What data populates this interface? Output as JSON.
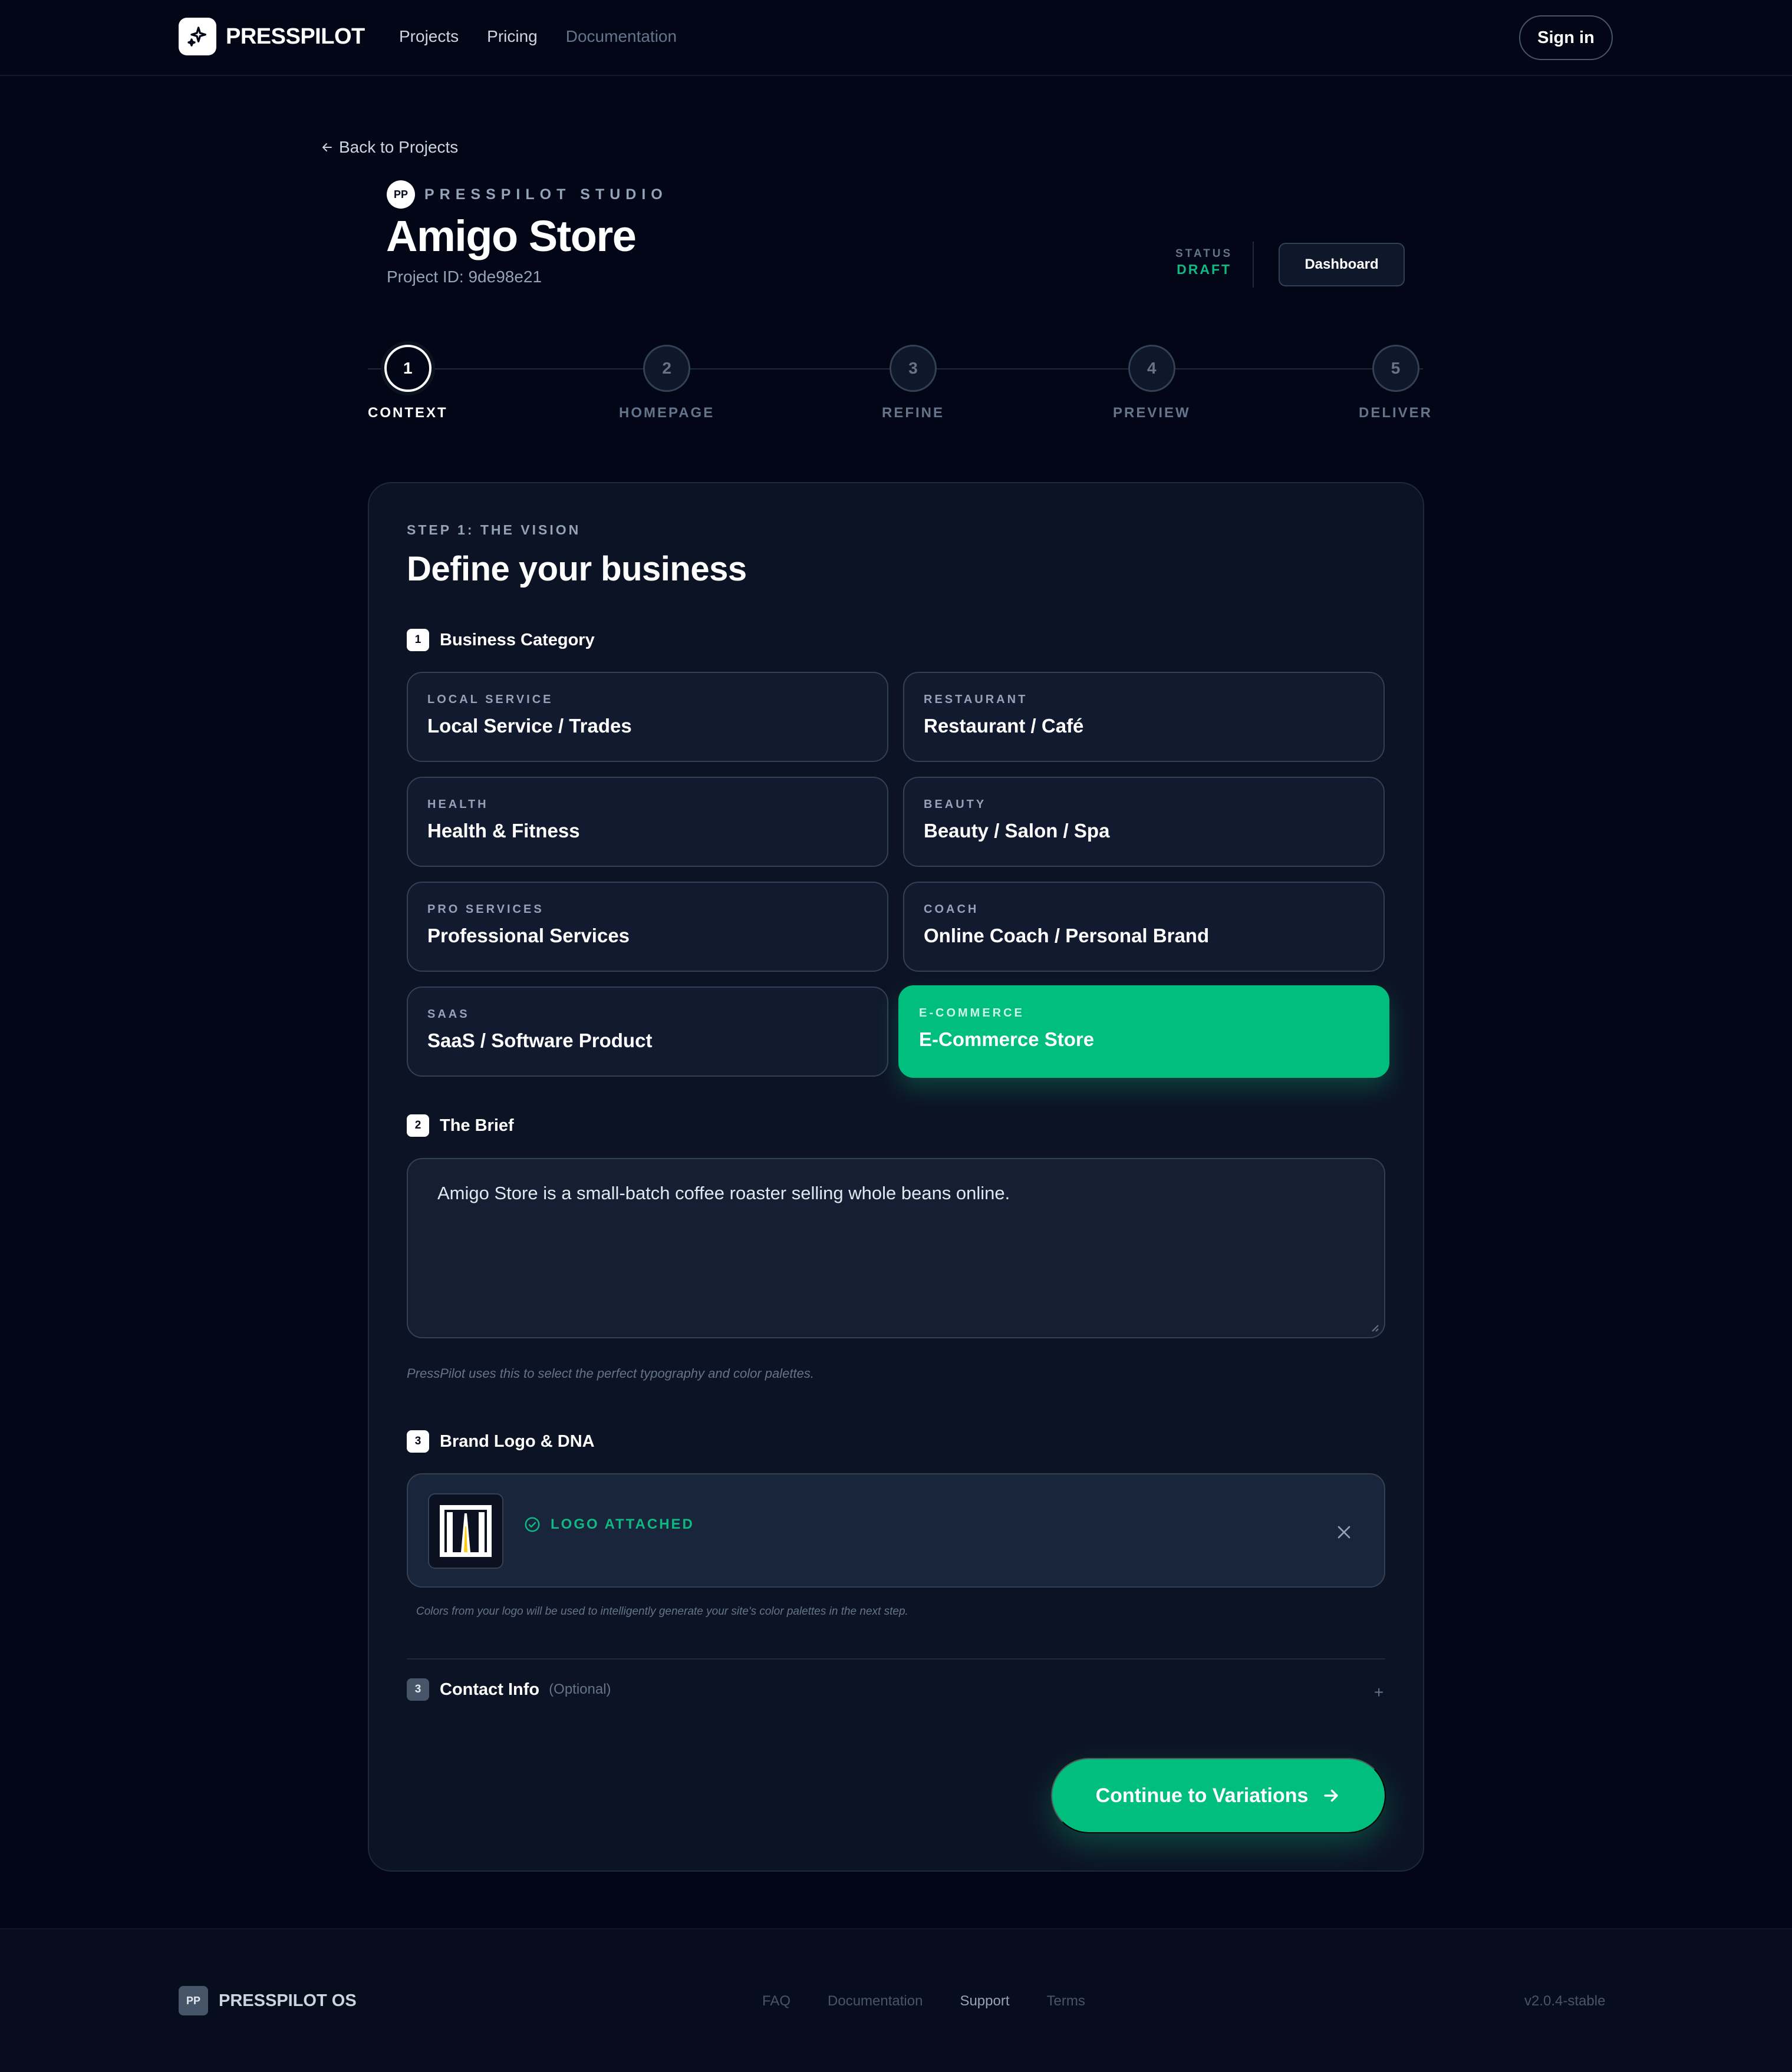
{
  "nav": {
    "brand": "PRESSPILOT",
    "links": [
      "Projects",
      "Pricing",
      "Documentation"
    ],
    "signin": "Sign in"
  },
  "header": {
    "back": "Back to Projects",
    "studio_badge": "PP",
    "studio_label": "PRESSPILOT STUDIO",
    "title": "Amigo Store",
    "project_id": "Project ID: 9de98e21",
    "status_label": "STATUS",
    "status_value": "DRAFT",
    "dashboard": "Dashboard"
  },
  "stepper": {
    "active": 1,
    "steps": [
      {
        "num": "1",
        "label": "CONTEXT"
      },
      {
        "num": "2",
        "label": "HOMEPAGE"
      },
      {
        "num": "3",
        "label": "REFINE"
      },
      {
        "num": "4",
        "label": "PREVIEW"
      },
      {
        "num": "5",
        "label": "DELIVER"
      }
    ]
  },
  "card": {
    "eyebrow": "STEP 1: THE VISION",
    "title": "Define your business",
    "section_category": {
      "num": "1",
      "label": "Business Category"
    },
    "categories": [
      {
        "kicker": "LOCAL SERVICE",
        "title": "Local Service / Trades"
      },
      {
        "kicker": "RESTAURANT",
        "title": "Restaurant / Café"
      },
      {
        "kicker": "HEALTH",
        "title": "Health & Fitness"
      },
      {
        "kicker": "BEAUTY",
        "title": "Beauty / Salon / Spa"
      },
      {
        "kicker": "PRO SERVICES",
        "title": "Professional Services"
      },
      {
        "kicker": "COACH",
        "title": "Online Coach / Personal Brand"
      },
      {
        "kicker": "SAAS",
        "title": "SaaS / Software Product"
      },
      {
        "kicker": "E-COMMERCE",
        "title": "E-Commerce Store"
      }
    ],
    "selected_category": "E-Commerce Store",
    "section_brief": {
      "num": "2",
      "label": "The Brief"
    },
    "brief_value": "Amigo Store is a small-batch coffee roaster selling whole beans online.",
    "brief_hint": "PressPilot uses this to select the perfect typography and color palettes.",
    "section_logo": {
      "num": "3",
      "label": "Brand Logo & DNA"
    },
    "logo_status": "LOGO ATTACHED",
    "logo_hint": "Colors from your logo will be used to intelligently generate your site's color palettes in the next step.",
    "section_contact": {
      "num": "3",
      "label": "Contact Info",
      "optional": "(Optional)"
    },
    "continue": "Continue to Variations"
  },
  "footer": {
    "badge": "PP",
    "brand": "PRESSPILOT OS",
    "links": [
      "FAQ",
      "Documentation",
      "Support",
      "Terms"
    ],
    "version": "v2.0.4-stable"
  },
  "colors": {
    "background": "#020617",
    "card": "#0c1324",
    "accent": "#00bf7e",
    "border": "#334155"
  },
  "icons": {
    "brand": "sparkle-icon",
    "back": "arrow-left-icon",
    "attached": "check-circle-icon",
    "remove": "close-icon",
    "expand": "plus-icon",
    "continue": "arrow-right-icon"
  }
}
